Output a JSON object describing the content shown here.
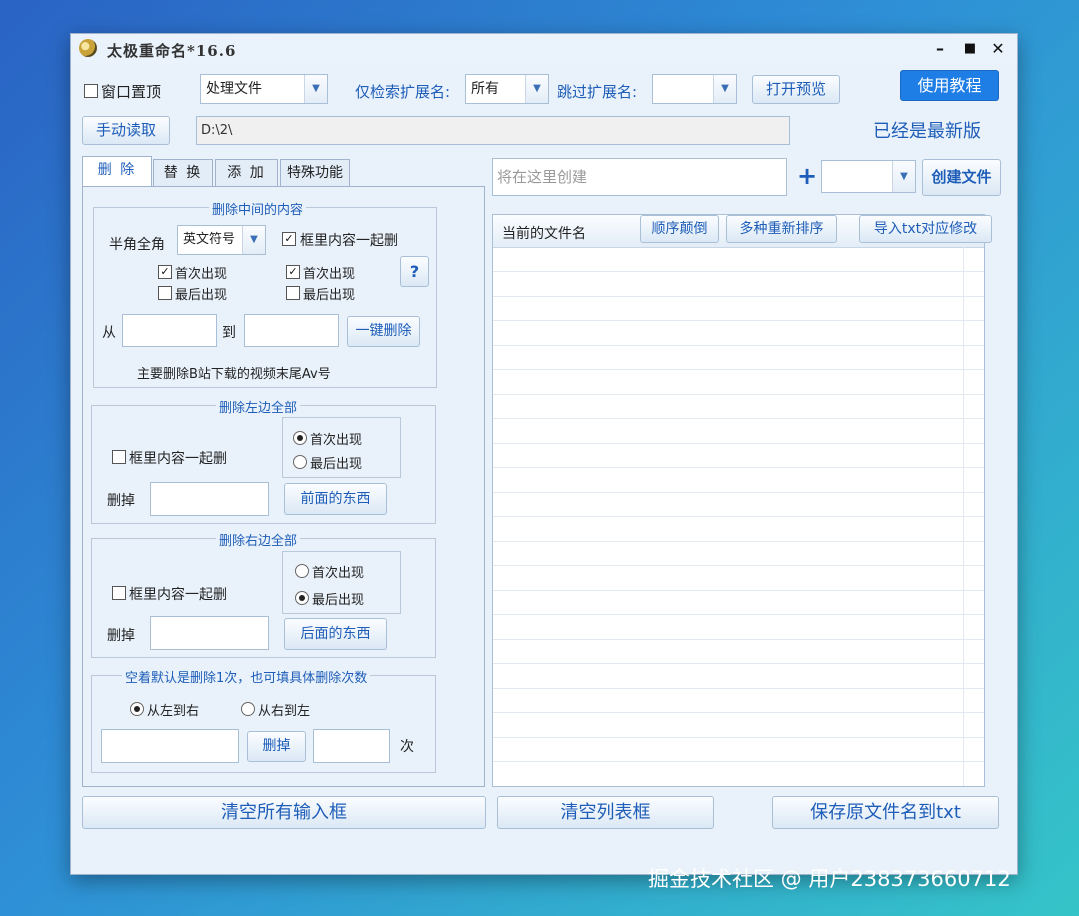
{
  "window": {
    "title": "太极重命名*16.6"
  },
  "toolbar": {
    "topmost_label": "窗口置顶",
    "mode_value": "处理文件",
    "only_ext_label": "仅检索扩展名:",
    "only_ext_value": "所有",
    "skip_ext_label": "跳过扩展名:",
    "skip_ext_value": "",
    "open_preview": "打开预览",
    "tutorial": "使用教程",
    "manual_read": "手动读取",
    "path_value": "D:\\2\\",
    "version_status": "已经是最新版"
  },
  "tabs": [
    "删 除",
    "替 换",
    "添 加",
    "特殊功能"
  ],
  "delete_middle": {
    "group_title": "删除中间的内容",
    "width_label": "半角全角",
    "width_value": "英文符号",
    "include_box_label": "框里内容一起删",
    "left_first": "首次出现",
    "left_last": "最后出现",
    "right_first": "首次出现",
    "right_last": "最后出现",
    "help": "?",
    "from_label": "从",
    "to_label": "到",
    "one_click": "一键删除",
    "hint": "主要删除B站下载的视频末尾Av号"
  },
  "delete_left": {
    "group_title": "删除左边全部",
    "include_box_label": "框里内容一起删",
    "first": "首次出现",
    "last": "最后出现",
    "remove_label": "删掉",
    "button": "前面的东西"
  },
  "delete_right": {
    "group_title": "删除右边全部",
    "include_box_label": "框里内容一起删",
    "first": "首次出现",
    "last": "最后出现",
    "remove_label": "删掉",
    "button": "后面的东西"
  },
  "delete_count": {
    "group_title": "空着默认是删除1次，也可填具体删除次数",
    "ltr": "从左到右",
    "rtl": "从右到左",
    "button": "删掉",
    "times": "次"
  },
  "right_panel": {
    "create_placeholder": "将在这里创建",
    "plus": "+",
    "create_button": "创建文件",
    "col_current": "当前的文件名",
    "reverse": "顺序颠倒",
    "resort": "多种重新排序",
    "import_txt": "导入txt对应修改"
  },
  "footer": {
    "clear_inputs": "清空所有输入框",
    "clear_list": "清空列表框",
    "save_txt": "保存原文件名到txt"
  },
  "watermark": "掘金技术社区 @ 用户2383736607​12"
}
